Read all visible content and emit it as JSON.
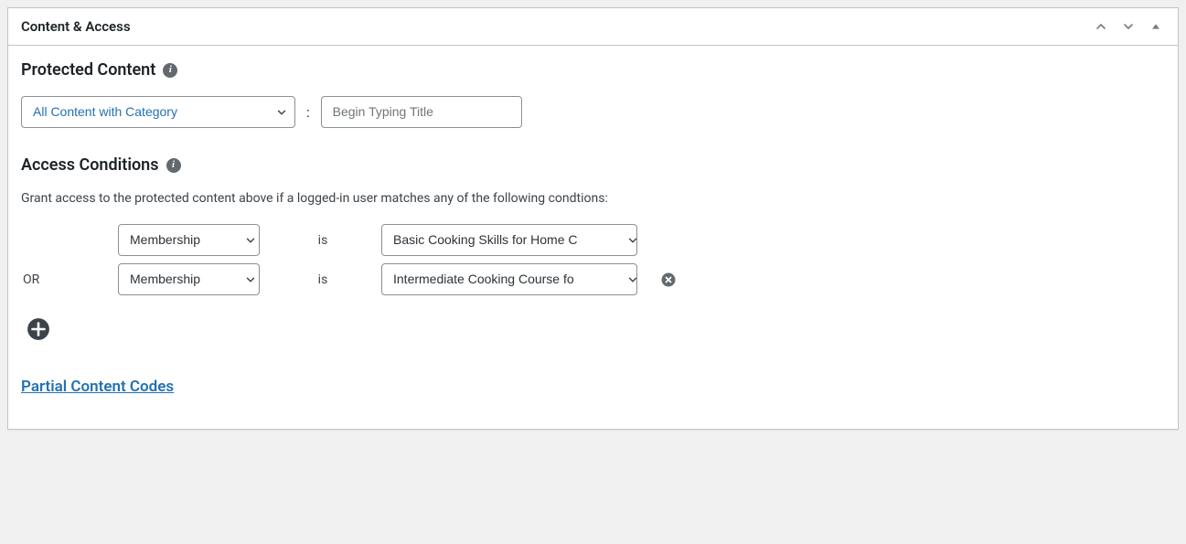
{
  "panel": {
    "title": "Content & Access"
  },
  "protected_content": {
    "heading": "Protected Content",
    "info_glyph": "i",
    "scope_select": {
      "selected": "All Content with Category"
    },
    "title_input": {
      "placeholder": "Begin Typing Title",
      "value": ""
    }
  },
  "access_conditions": {
    "heading": "Access Conditions",
    "info_glyph": "i",
    "description": "Grant access to the protected content above if a logged-in user matches any of the following condtions:",
    "operator_label": "OR",
    "is_label": "is",
    "rows": [
      {
        "type": "Membership",
        "value": "Basic Cooking Skills for Home C"
      },
      {
        "type": "Membership",
        "value": "Intermediate Cooking Course fo"
      }
    ]
  },
  "partial_codes_link": "Partial Content Codes"
}
